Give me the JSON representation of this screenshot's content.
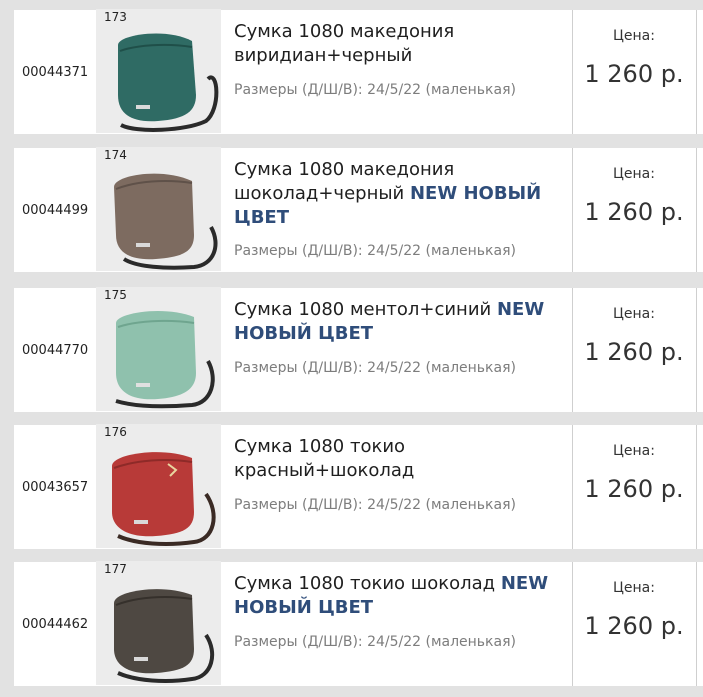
{
  "price_label": "Цена:",
  "items": [
    {
      "code": "00044371",
      "num": "173",
      "title": "Сумка 1080 македония виридиан+черный",
      "badge": "",
      "size": "Размеры (Д/Ш/В): 24/5/22 (маленькая)",
      "price": "1 260 р.",
      "color": "#2f6b64"
    },
    {
      "code": "00044499",
      "num": "174",
      "title": "Сумка 1080 македония шоколад+черный ",
      "badge": "NEW НОВЫЙ ЦВЕТ",
      "size": "Размеры (Д/Ш/В): 24/5/22 (маленькая)",
      "price": "1 260 р.",
      "color": "#7d6b60"
    },
    {
      "code": "00044770",
      "num": "175",
      "title": "Сумка 1080 ментол+синий ",
      "badge": "NEW НОВЫЙ ЦВЕТ",
      "size": "Размеры (Д/Ш/В): 24/5/22 (маленькая)",
      "price": "1 260 р.",
      "color": "#8fc1ad"
    },
    {
      "code": "00043657",
      "num": "176",
      "title": "Сумка 1080 токио красный+шоколад",
      "badge": "",
      "size": "Размеры (Д/Ш/В): 24/5/22 (маленькая)",
      "price": "1 260 р.",
      "color": "#b83a38"
    },
    {
      "code": "00044462",
      "num": "177",
      "title": "Сумка 1080 токио шоколад ",
      "badge": "NEW НОВЫЙ ЦВЕТ",
      "size": "Размеры (Д/Ш/В): 24/5/22 (маленькая)",
      "price": "1 260 р.",
      "color": "#4e4842"
    }
  ]
}
